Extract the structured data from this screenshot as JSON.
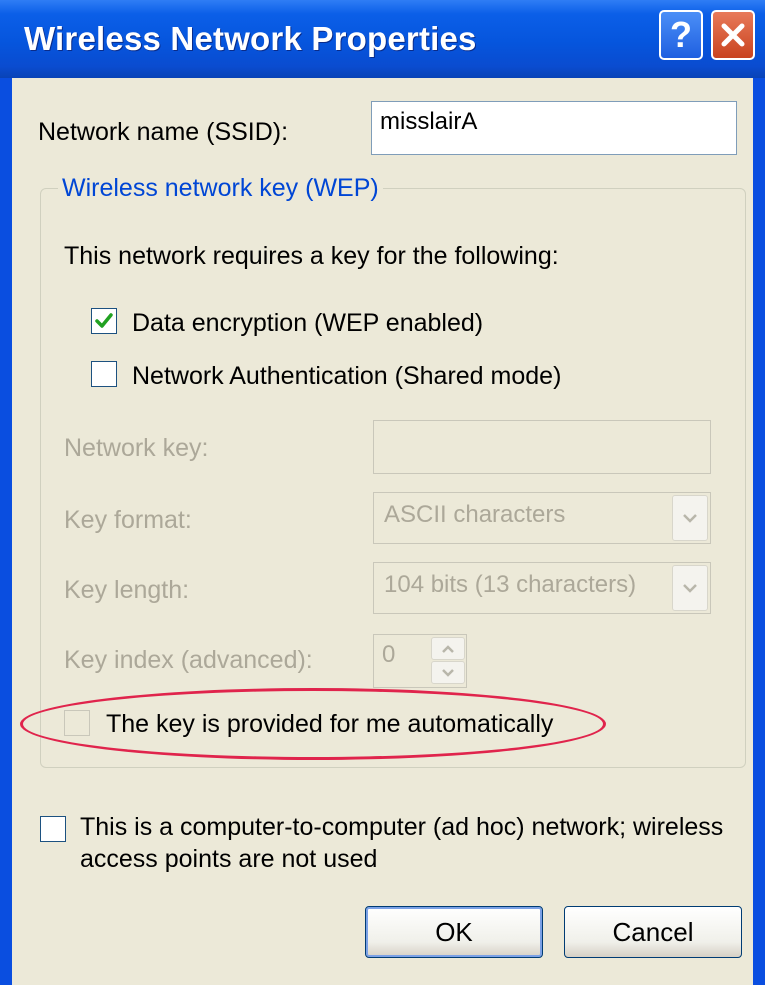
{
  "window": {
    "title": "Wireless Network Properties"
  },
  "titlebar": {
    "help_glyph": "?",
    "close_icon": "close-icon"
  },
  "ssid": {
    "label": "Network name (SSID):",
    "value": "misslairA"
  },
  "wep_group": {
    "title": "Wireless network key (WEP)",
    "intro": "This network requires a key for the following:",
    "data_encryption": {
      "label": "Data encryption (WEP enabled)",
      "checked": true
    },
    "network_auth": {
      "label": "Network Authentication (Shared mode)",
      "checked": false
    },
    "network_key": {
      "label": "Network key:",
      "value": ""
    },
    "key_format": {
      "label": "Key format:",
      "value": "ASCII characters"
    },
    "key_length": {
      "label": "Key length:",
      "value": "104 bits (13 characters)"
    },
    "key_index": {
      "label": "Key index (advanced):",
      "value": "0"
    },
    "auto_key": {
      "label": "The key is provided for me automatically",
      "checked": false
    }
  },
  "adhoc": {
    "label_line1": "This is a computer-to-computer (ad hoc) network; wireless",
    "label_line2": "access points are not used",
    "checked": false
  },
  "buttons": {
    "ok": "OK",
    "cancel": "Cancel"
  },
  "colors": {
    "titlebar": "#0655dd",
    "group_title": "#0046d5",
    "highlight_ellipse": "#e0244c",
    "dialog_bg": "#ece9d8"
  }
}
